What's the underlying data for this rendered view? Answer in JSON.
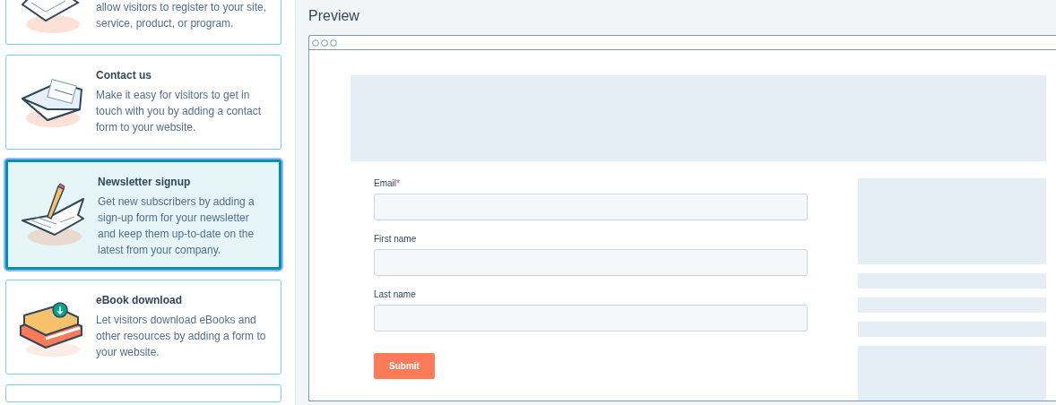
{
  "templates": [
    {
      "kind": "registration",
      "description": "allow visitors to register to your site, service, product, or program.",
      "selected": false
    },
    {
      "kind": "envelope",
      "title": "Contact us",
      "description": "Make it easy for visitors to get in touch with you by adding a contact form to your website.",
      "selected": false
    },
    {
      "kind": "newsletter",
      "title": "Newsletter signup",
      "description": "Get new subscribers by adding a sign-up form for your newsletter and keep them up-to-date on the latest from your company.",
      "selected": true
    },
    {
      "kind": "ebook",
      "title": "eBook download",
      "description": "Let visitors download eBooks and other resources by adding a form to your website.",
      "selected": false
    }
  ],
  "preview": {
    "title": "Preview",
    "fields": [
      {
        "label": "Email",
        "required": true
      },
      {
        "label": "First name",
        "required": false
      },
      {
        "label": "Last name",
        "required": false
      }
    ],
    "required_mark": "*",
    "submit": "Submit"
  }
}
